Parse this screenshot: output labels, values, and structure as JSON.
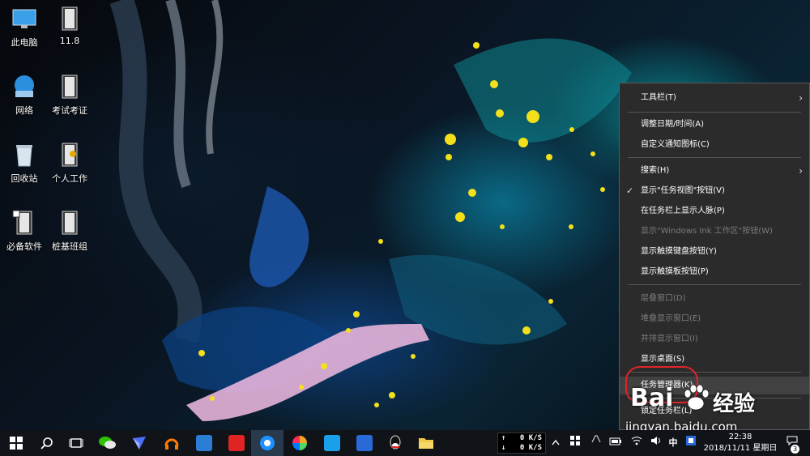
{
  "desktop_icons": [
    {
      "label": "此电脑",
      "icon": "computer-icon"
    },
    {
      "label": "11.8",
      "icon": "folder-icon"
    },
    {
      "label": "网络",
      "icon": "network-icon"
    },
    {
      "label": "考试考证",
      "icon": "folder-icon"
    },
    {
      "label": "回收站",
      "icon": "recycle-bin-icon"
    },
    {
      "label": "个人工作",
      "icon": "folder-icon"
    },
    {
      "label": "必备软件",
      "icon": "folder-icon"
    },
    {
      "label": "桩基班组",
      "icon": "folder-icon"
    }
  ],
  "context_menu": {
    "items": [
      {
        "label": "工具栏(T)",
        "submenu": true,
        "enabled": true
      },
      {
        "label": "调整日期/时间(A)",
        "enabled": true
      },
      {
        "label": "自定义通知图标(C)",
        "enabled": true
      },
      {
        "label": "搜索(H)",
        "submenu": true,
        "enabled": true
      },
      {
        "label": "显示\"任务视图\"按钮(V)",
        "checked": true,
        "enabled": true
      },
      {
        "label": "在任务栏上显示人脉(P)",
        "enabled": true
      },
      {
        "label": "显示\"Windows Ink 工作区\"按钮(W)",
        "enabled": false
      },
      {
        "label": "显示触摸键盘按钮(Y)",
        "enabled": true
      },
      {
        "label": "显示触摸板按钮(P)",
        "enabled": true
      },
      {
        "label": "层叠窗口(D)",
        "enabled": false
      },
      {
        "label": "堆叠显示窗口(E)",
        "enabled": false
      },
      {
        "label": "并排显示窗口(I)",
        "enabled": false
      },
      {
        "label": "显示桌面(S)",
        "enabled": true
      },
      {
        "label": "任务管理器(K)",
        "enabled": true,
        "highlighted": true
      },
      {
        "label": "锁定任务栏(L)",
        "enabled": true
      }
    ],
    "check_glyph": "✓",
    "submenu_glyph": "›"
  },
  "watermark": {
    "brand": "Bai",
    "product": "经验",
    "url": "jingyan.baidu.com"
  },
  "taskbar": {
    "apps": [
      {
        "icon": "start-icon"
      },
      {
        "icon": "search-icon"
      },
      {
        "icon": "task-view-icon"
      },
      {
        "icon": "wechat-icon",
        "color": "#2dc100"
      },
      {
        "icon": "feishu-icon",
        "color": "#4b6ef5"
      },
      {
        "icon": "headset-icon",
        "color": "#ff7a00"
      },
      {
        "icon": "office-icon",
        "color": "#2b7cd3"
      },
      {
        "icon": "it-icon",
        "color": "#e02424"
      },
      {
        "icon": "edge-icon",
        "color": "#1e90ff"
      },
      {
        "icon": "color-wheel-icon",
        "color": "#f5a623"
      },
      {
        "icon": "qq-headphone-icon",
        "color": "#1aa0e8"
      },
      {
        "icon": "nav-app-icon",
        "color": "#2a6ad8"
      },
      {
        "icon": "qq-icon",
        "color": "#111111"
      },
      {
        "icon": "file-explorer-icon",
        "color": "#f2c84b"
      }
    ],
    "net_up": "0 K/S",
    "net_down": "0 K/S",
    "net_up_arrow": "↑",
    "net_down_arrow": "↓",
    "tray_ime": "中",
    "clock_time": "22:38",
    "clock_date": "2018/11/11 星期日",
    "notification_count": "3"
  }
}
